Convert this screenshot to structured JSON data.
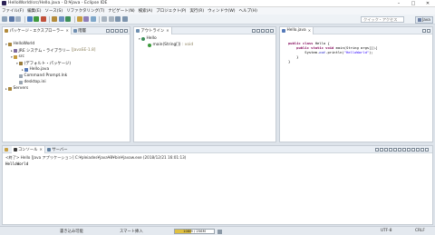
{
  "window": {
    "title": "HelloWorld/src/Hello.java - D:¥java - Eclipse IDE"
  },
  "menu": [
    "ファイル(F)",
    "編集(E)",
    "ソース(S)",
    "リファクタリング(T)",
    "ナビゲート(N)",
    "検索(A)",
    "プロジェクト(P)",
    "実行(R)",
    "ウィンドウ(W)",
    "ヘルプ(H)"
  ],
  "toolbar": {
    "quick_access_placeholder": "クイック・アクセス",
    "perspective_label": "Java"
  },
  "package_explorer": {
    "tab_label": "パッケージ・エクスプローラー",
    "second_tab_label": "階層",
    "tree": [
      {
        "label": "HelloWorld",
        "decoration": ""
      },
      {
        "label": "JRE システム・ライブラリー",
        "decoration": "[JavaSE-1.8]"
      },
      {
        "label": "src",
        "decoration": ""
      },
      {
        "label": "(デフォルト・パッケージ)",
        "decoration": ""
      },
      {
        "label": "Hello.java",
        "decoration": ""
      },
      {
        "label": "Command Prompt.lnk",
        "decoration": ""
      },
      {
        "label": "desktop.ini",
        "decoration": ""
      },
      {
        "label": "Servers",
        "decoration": ""
      }
    ]
  },
  "outline": {
    "tab_label": "アウトライン",
    "class_name": "Hello",
    "method_name": "main(String[])",
    "method_type": ": void"
  },
  "editor": {
    "tab_label": "Hello.java",
    "code_lines": [
      {
        "html": ""
      },
      {
        "html": "<span class='kw'>public class</span> Hello {"
      },
      {
        "html": "    <span class='kw'>public static void</span> main(String args[]){"
      },
      {
        "html": "        System.<span class='fld'>out</span>.println(<span class='str'>\"HelloWorld\"</span>);"
      },
      {
        "html": "    }"
      },
      {
        "html": "}"
      }
    ]
  },
  "console": {
    "tab_label": "コンソール",
    "second_tab_label": "サーバー",
    "description": "<終了> Hello [Java アプリケーション] C:¥pleiades¥java¥8¥bin¥javaw.exe (2018/12/21 16:01:13)",
    "output": "HelloWorld"
  },
  "status": {
    "writable": "書き込み可能",
    "insert_mode": "スマート挿入",
    "heap_text": "108M / 256M",
    "heap_fraction": 0.42,
    "encoding": "UTF-8",
    "line_delimiter": "CRLF"
  },
  "colors": {
    "java_keyword": "#7f0055",
    "string": "#2a00ff",
    "field": "#0000c0",
    "panel_header": "#e9eef4",
    "heap_fill": "#e0c040"
  }
}
